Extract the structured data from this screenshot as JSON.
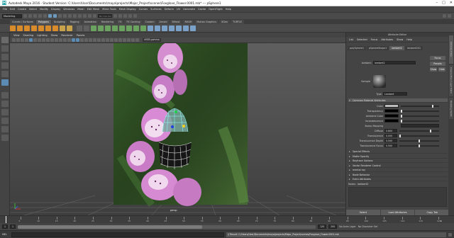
{
  "window": {
    "title": "Autodesk Maya 2016 - Student Version: C:\\Users\\User\\Documents\\maya\\projects\\Major_Project\\scenes\\Foxglove_Flower.0001.mb* --- pSphere1",
    "controls": [
      "–",
      "□",
      "✕"
    ]
  },
  "menubar": [
    "File",
    "Edit",
    "Create",
    "Select",
    "Modify",
    "Display",
    "Windows",
    "Mesh",
    "Edit Mesh",
    "Mesh Tools",
    "Mesh Display",
    "Curves",
    "Surfaces",
    "Deform",
    "UV",
    "Generate",
    "Cache",
    "OpenFlight",
    "Help"
  ],
  "status": {
    "mode": "Modeling",
    "live_surface": "No Live Surface"
  },
  "shelf_tabs": [
    {
      "label": "Curves / Surfaces",
      "active": false
    },
    {
      "label": "Polygons",
      "active": true
    },
    {
      "label": "Sculpting",
      "active": false
    },
    {
      "label": "Rigging",
      "active": false
    },
    {
      "label": "Animation",
      "active": false
    },
    {
      "label": "Rendering",
      "active": false
    },
    {
      "label": "FX",
      "active": false
    },
    {
      "label": "FX Caching",
      "active": false
    },
    {
      "label": "Custom",
      "active": false
    },
    {
      "label": "Arnold",
      "active": false
    },
    {
      "label": "Bifrost",
      "active": false
    },
    {
      "label": "MASH",
      "active": false
    },
    {
      "label": "Motion Graphics",
      "active": false
    },
    {
      "label": "XGen",
      "active": false
    },
    {
      "label": "TURTLE",
      "active": false
    }
  ],
  "viewport": {
    "menu": [
      "View",
      "Shading",
      "Lighting",
      "Show",
      "Renderer",
      "Panels"
    ],
    "gamma": "sRGB gamma",
    "camera_label": "persp"
  },
  "attribute_editor": {
    "title": "Attribute Editor",
    "menu": [
      "List",
      "Selected",
      "Focus",
      "Attributes",
      "Show",
      "Help"
    ],
    "tabs": [
      {
        "label": "polySphere1",
        "active": false
      },
      {
        "label": "pSphereShape1",
        "active": false
      },
      {
        "label": "lambert2",
        "active": true
      },
      {
        "label": "lambert2SG",
        "active": false
      }
    ],
    "node_type_label": "lambert:",
    "node_name": "lambert2",
    "focus_btn": "Focus",
    "presets_btn": "Presets",
    "show_btn": "Show",
    "hide_btn": "Hide",
    "sample_label": "Sample",
    "type_label": "Type",
    "type_value": "Lambert",
    "common_section": "Common Material Attributes",
    "attributes": [
      {
        "label": "Color",
        "value": ""
      },
      {
        "label": "Transparency",
        "value": ""
      },
      {
        "label": "Ambient Color",
        "value": ""
      },
      {
        "label": "Incandescence",
        "value": ""
      },
      {
        "label": "Bump Mapping",
        "value": ""
      },
      {
        "label": "Diffuse",
        "value": "0.800"
      },
      {
        "label": "Translucence",
        "value": "0.000"
      },
      {
        "label": "Translucence Depth",
        "value": "0.500"
      },
      {
        "label": "Translucence Focus",
        "value": "0.500"
      }
    ],
    "collapsed_sections": [
      "Special Effects",
      "Matte Opacity",
      "Raytrace Options",
      "Vector Renderer Control",
      "mental ray",
      "Node Behavior",
      "Extra Attributes"
    ],
    "notes_label": "Notes:",
    "notes_value": "lambert2",
    "bottom_buttons": [
      "Select",
      "Load Attributes",
      "Copy Tab"
    ]
  },
  "side_tabs": [
    "Attribute Editor",
    "Channel Box / Layer Editor",
    "Modeling Toolkit"
  ],
  "timeline": {
    "ticks": [
      "5",
      "10",
      "15",
      "20",
      "25",
      "30",
      "35",
      "40",
      "45",
      "50",
      "55",
      "60",
      "65",
      "70",
      "75",
      "80",
      "85",
      "90",
      "95",
      "100",
      "105",
      "110",
      "115",
      "120"
    ],
    "current_frame": "1"
  },
  "range": {
    "start": "1",
    "start2": "1",
    "end": "120",
    "end2": "200",
    "anim_layer": "No Anim Layer",
    "char_set": "No Character Set"
  },
  "command_line": {
    "lang": "MEL",
    "result": "// Result: C:/Users/User/Documents/maya/projects/Major_Project/scenes/Foxglove_Flower.0001.mb"
  }
}
